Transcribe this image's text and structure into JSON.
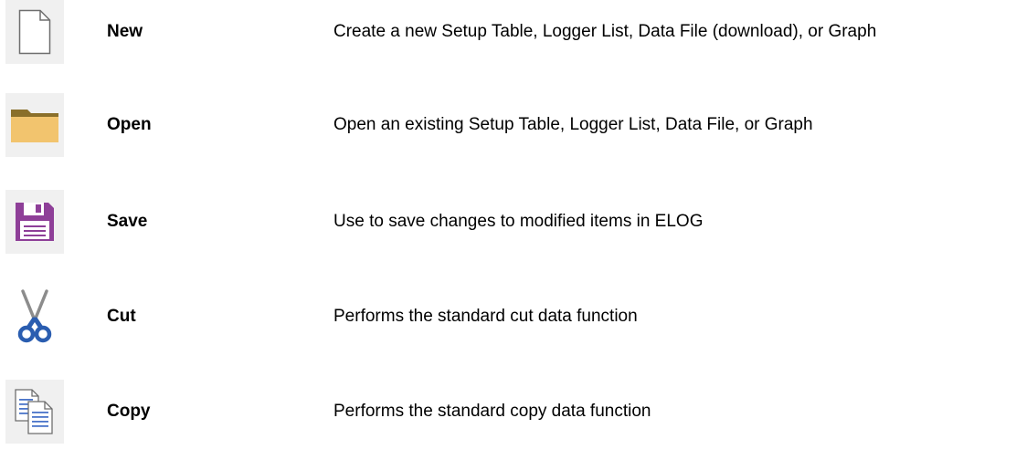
{
  "toolbar_commands": [
    {
      "name": "New",
      "icon": "new-document-icon",
      "description": "Create a new Setup Table, Logger List, Data File (download), or Graph"
    },
    {
      "name": "Open",
      "icon": "open-folder-icon",
      "description": "Open an existing Setup Table, Logger List, Data File, or Graph"
    },
    {
      "name": "Save",
      "icon": "save-floppy-icon",
      "description": "Use to save changes to modified items in ELOG"
    },
    {
      "name": "Cut",
      "icon": "scissors-icon",
      "description": "Performs the standard cut data function"
    },
    {
      "name": "Copy",
      "icon": "copy-pages-icon",
      "description": "Performs the standard copy data function"
    }
  ],
  "colors": {
    "icon_background": "#f0f0f0",
    "folder_tab": "#8a6f2a",
    "folder_body": "#f2c46e",
    "floppy_purple": "#8e3f98",
    "scissors_blue": "#2a5db0",
    "scissors_blade": "#8c8c8c"
  }
}
